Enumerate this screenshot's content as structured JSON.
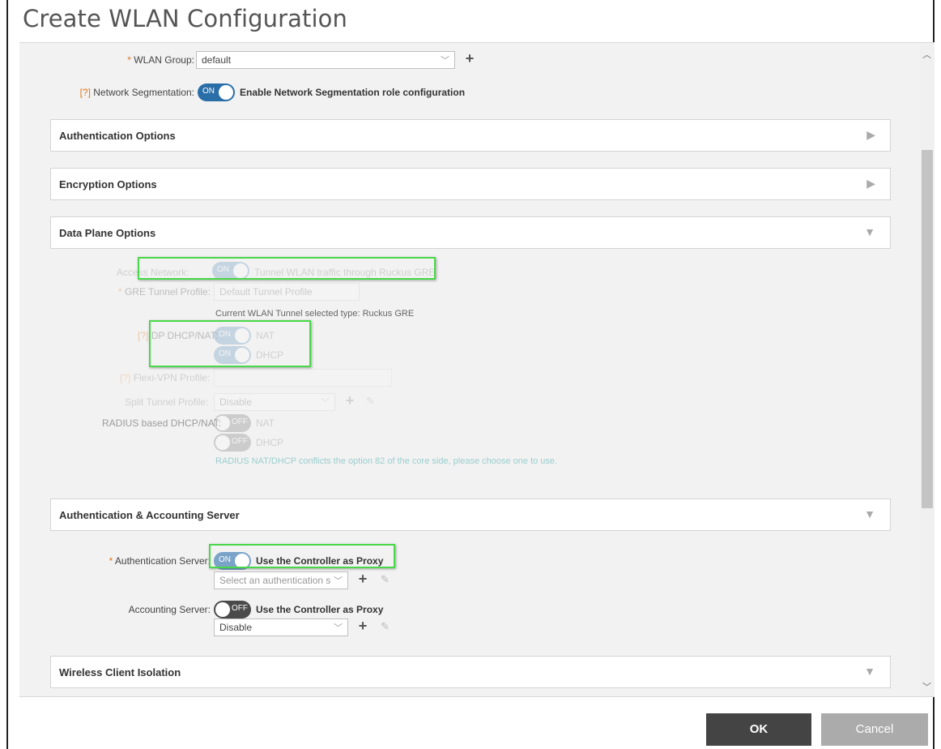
{
  "dialog": {
    "title": "Create WLAN Configuration"
  },
  "wlan_group": {
    "label": "WLAN Group:",
    "value": "default"
  },
  "network_segmentation": {
    "label": "Network Segmentation:",
    "help": "[?]",
    "toggle": "ON",
    "text": "Enable Network Segmentation role configuration"
  },
  "sections": {
    "auth_options": "Authentication Options",
    "encryption_options": "Encryption Options",
    "data_plane_options": "Data Plane Options",
    "auth_acct_server": "Authentication & Accounting Server",
    "wireless_client_isolation": "Wireless Client Isolation"
  },
  "data_plane": {
    "access_network_label": "Access Network:",
    "access_network_toggle": "ON",
    "access_network_text": "Tunnel WLAN traffic through Ruckus GRE",
    "gre_label": "GRE Tunnel Profile:",
    "gre_value": "Default Tunnel Profile",
    "tunnel_type_note": "Current WLAN Tunnel selected type: Ruckus GRE",
    "dp_dhcp_help": "[?]",
    "dp_dhcp_label": "DP DHCP/NAT:",
    "nat_toggle": "ON",
    "nat_text": "NAT",
    "dhcp_toggle": "ON",
    "dhcp_text": "DHCP",
    "flexi_vpn_help": "[?]",
    "flexi_vpn_label": "Flexi-VPN Profile:",
    "split_tunnel_label": "Split Tunnel Profile:",
    "split_tunnel_value": "Disable",
    "radius_label": "RADIUS based DHCP/NAT:",
    "radius_nat_toggle": "OFF",
    "radius_nat_text": "NAT",
    "radius_dhcp_toggle": "OFF",
    "radius_dhcp_text": "DHCP",
    "radius_warning": "RADIUS NAT/DHCP conflicts the option 82 of the core side, please choose one to use."
  },
  "auth_server": {
    "label": "Authentication Server:",
    "toggle": "ON",
    "proxy_text": "Use the Controller as Proxy",
    "placeholder": "Select an authentication s"
  },
  "acct_server": {
    "label": "Accounting Server:",
    "toggle": "OFF",
    "proxy_text": "Use the Controller as Proxy",
    "value": "Disable"
  },
  "buttons": {
    "ok": "OK",
    "cancel": "Cancel"
  },
  "colors": {
    "accent": "#2a6ea8",
    "highlight": "#49d849",
    "required": "#e0761a"
  }
}
